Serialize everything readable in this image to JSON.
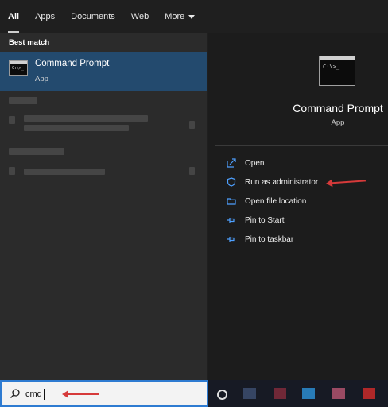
{
  "tabs": [
    {
      "label": "All"
    },
    {
      "label": "Apps"
    },
    {
      "label": "Documents"
    },
    {
      "label": "Web"
    },
    {
      "label": "More"
    }
  ],
  "left": {
    "section_label": "Best match",
    "best_match": {
      "title": "Command Prompt",
      "subtitle": "App"
    }
  },
  "detail": {
    "title": "Command Prompt",
    "subtitle": "App",
    "actions": [
      {
        "label": "Open",
        "icon": "open-icon"
      },
      {
        "label": "Run as administrator",
        "icon": "shield-icon"
      },
      {
        "label": "Open file location",
        "icon": "folder-icon"
      },
      {
        "label": "Pin to Start",
        "icon": "pin-icon"
      },
      {
        "label": "Pin to taskbar",
        "icon": "pin-icon"
      }
    ]
  },
  "search": {
    "query": "cmd",
    "icon": "search-icon"
  },
  "colors": {
    "accent_selected": "#234a6e",
    "annotation_arrow": "#d63a3a",
    "action_icon": "#4ea0ff",
    "search_border": "#2e7bd1"
  }
}
